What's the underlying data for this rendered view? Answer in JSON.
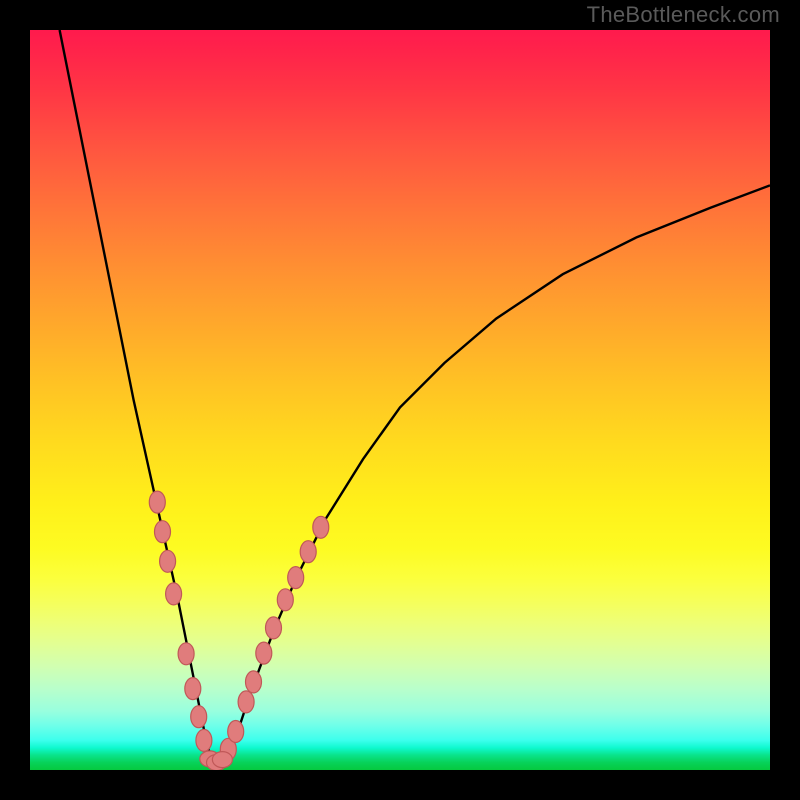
{
  "watermark": "TheBottleneck.com",
  "colors": {
    "frame": "#000000",
    "curve": "#000000",
    "dot_fill": "#e07c7c",
    "dot_stroke": "#c05858"
  },
  "chart_data": {
    "type": "line",
    "title": "",
    "xlabel": "",
    "ylabel": "",
    "x_range": [
      0,
      100
    ],
    "y_range": [
      0,
      100
    ],
    "description": "V-shaped bottleneck curve on rainbow gradient; minimum near x≈25, left branch steep to top-left, right branch rises with decreasing slope to upper-right.",
    "series": [
      {
        "name": "bottleneck-curve",
        "x": [
          4,
          6,
          8,
          10,
          12,
          14,
          16,
          18,
          20,
          22,
          23,
          24,
          25,
          26,
          27,
          28,
          30,
          33,
          36,
          40,
          45,
          50,
          56,
          63,
          72,
          82,
          92,
          100
        ],
        "y": [
          100,
          90,
          80,
          70,
          60,
          50,
          41,
          32,
          23,
          13,
          8,
          3,
          1,
          1,
          2,
          5,
          11,
          19,
          26,
          34,
          42,
          49,
          55,
          61,
          67,
          72,
          76,
          79
        ]
      }
    ],
    "dots_left": [
      {
        "x": 17.2,
        "y": 36.2
      },
      {
        "x": 17.9,
        "y": 32.2
      },
      {
        "x": 18.6,
        "y": 28.2
      },
      {
        "x": 19.4,
        "y": 23.8
      },
      {
        "x": 21.1,
        "y": 15.7
      },
      {
        "x": 22.0,
        "y": 11.0
      },
      {
        "x": 22.8,
        "y": 7.2
      },
      {
        "x": 23.5,
        "y": 4.0
      }
    ],
    "dots_right": [
      {
        "x": 26.8,
        "y": 2.8
      },
      {
        "x": 27.8,
        "y": 5.2
      },
      {
        "x": 29.2,
        "y": 9.2
      },
      {
        "x": 30.2,
        "y": 11.9
      },
      {
        "x": 31.6,
        "y": 15.8
      },
      {
        "x": 32.9,
        "y": 19.2
      },
      {
        "x": 34.5,
        "y": 23.0
      },
      {
        "x": 35.9,
        "y": 26.0
      },
      {
        "x": 37.6,
        "y": 29.5
      },
      {
        "x": 39.3,
        "y": 32.8
      }
    ],
    "dots_bottom": [
      {
        "x": 24.3,
        "y": 1.5
      },
      {
        "x": 25.2,
        "y": 1.0
      },
      {
        "x": 26.0,
        "y": 1.4
      }
    ]
  }
}
